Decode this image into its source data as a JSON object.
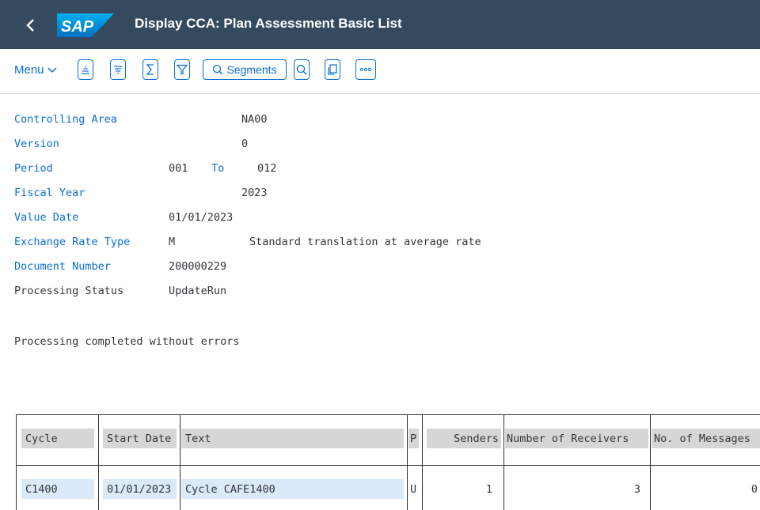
{
  "shell": {
    "logo_text": "SAP",
    "title": "Display CCA: Plan Assessment Basic List"
  },
  "toolbar": {
    "menu_label": "Menu",
    "segments_label": "Segments"
  },
  "header_fields": {
    "controlling_area": {
      "label": "Controlling Area",
      "value": "NA00"
    },
    "version": {
      "label": "Version",
      "value": "0"
    },
    "period": {
      "label": "Period",
      "from": "001",
      "to_label": "To",
      "to": "012"
    },
    "fiscal_year": {
      "label": "Fiscal Year",
      "value": "2023"
    },
    "value_date": {
      "label": "Value Date",
      "value": "01/01/2023"
    },
    "exchange_rate_type": {
      "label": "Exchange Rate Type",
      "value": "M",
      "description": "Standard translation at average rate"
    },
    "document_number": {
      "label": "Document Number",
      "value": "200000229"
    },
    "processing_status": {
      "label": "Processing Status",
      "value": "UpdateRun"
    }
  },
  "message": "Processing completed without errors",
  "table": {
    "columns": [
      "Cycle",
      "Start Date",
      "Text",
      "P",
      "Senders",
      "Number of Receivers",
      "No. of Messages"
    ],
    "rows": [
      [
        "C1400",
        "01/01/2023",
        "Cycle CAFE1400",
        "U",
        "1",
        "3",
        "0"
      ]
    ]
  }
}
